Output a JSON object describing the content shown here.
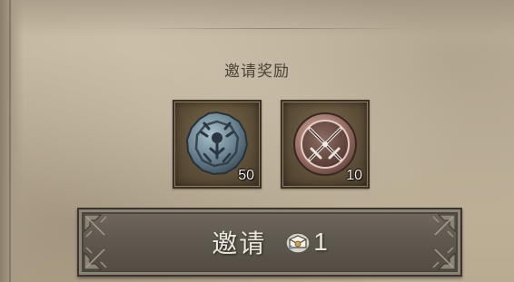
{
  "panel": {
    "title": "邀请奖励"
  },
  "rewards": [
    {
      "icon": "stone-rune-coin-icon",
      "quantity": "50"
    },
    {
      "icon": "crossed-swords-medal-icon",
      "quantity": "10"
    }
  ],
  "invite_button": {
    "label": "邀请",
    "cost_icon": "invite-letter-icon",
    "cost_amount": "1"
  },
  "colors": {
    "parchment": "#c2b59d",
    "title_text": "#4b4237",
    "slot_frame": "#5f5039",
    "button_face": "#5d574e",
    "button_text": "#ece7dc"
  }
}
